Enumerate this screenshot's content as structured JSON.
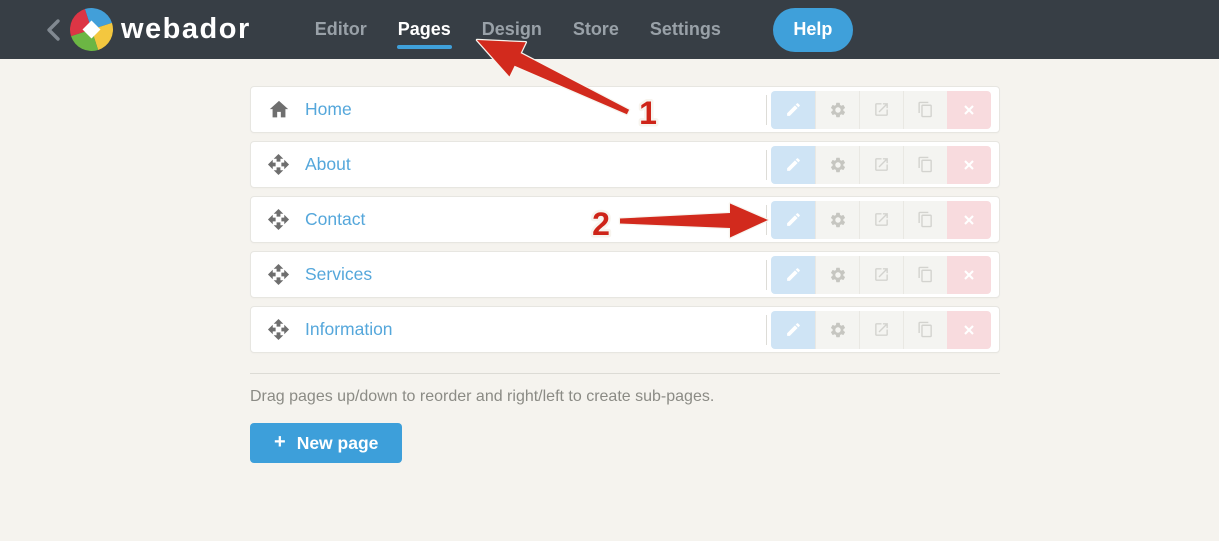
{
  "header": {
    "brand": "webador",
    "nav": [
      {
        "label": "Editor",
        "active": false
      },
      {
        "label": "Pages",
        "active": true
      },
      {
        "label": "Design",
        "active": false
      },
      {
        "label": "Store",
        "active": false
      },
      {
        "label": "Settings",
        "active": false
      }
    ],
    "help_label": "Help",
    "icons": {
      "back": "chevron-left-icon",
      "logo": "webador-pinwheel-logo"
    }
  },
  "pages": {
    "rows": [
      {
        "name": "Home",
        "left_icon": "home-icon"
      },
      {
        "name": "About",
        "left_icon": "move-icon"
      },
      {
        "name": "Contact",
        "left_icon": "move-icon"
      },
      {
        "name": "Services",
        "left_icon": "move-icon"
      },
      {
        "name": "Information",
        "left_icon": "move-icon"
      }
    ],
    "row_actions": [
      {
        "name": "edit",
        "icon": "pencil-icon"
      },
      {
        "name": "settings",
        "icon": "gear-icon"
      },
      {
        "name": "open-page",
        "icon": "external-link-icon"
      },
      {
        "name": "duplicate",
        "icon": "copy-pages-icon"
      },
      {
        "name": "delete",
        "icon": "x-icon"
      }
    ],
    "hint": "Drag pages up/down to reorder and right/left to create sub-pages.",
    "new_page": {
      "plus": "+",
      "label": "New page"
    }
  },
  "annotations": {
    "step1": "1",
    "step2": "2"
  },
  "colors": {
    "header_bg": "#373e45",
    "accent_blue": "#3fa0da",
    "link_blue": "#55a7db",
    "page_bg": "#f5f3ee",
    "edit_btn_bg": "#cfe4f5",
    "delete_btn_bg": "#f8dbde",
    "arrow_red": "#d22a1d",
    "logo_red": "#dc3545",
    "logo_blue": "#429fd9",
    "logo_yellow": "#f3c73f",
    "logo_green": "#6cb644"
  }
}
